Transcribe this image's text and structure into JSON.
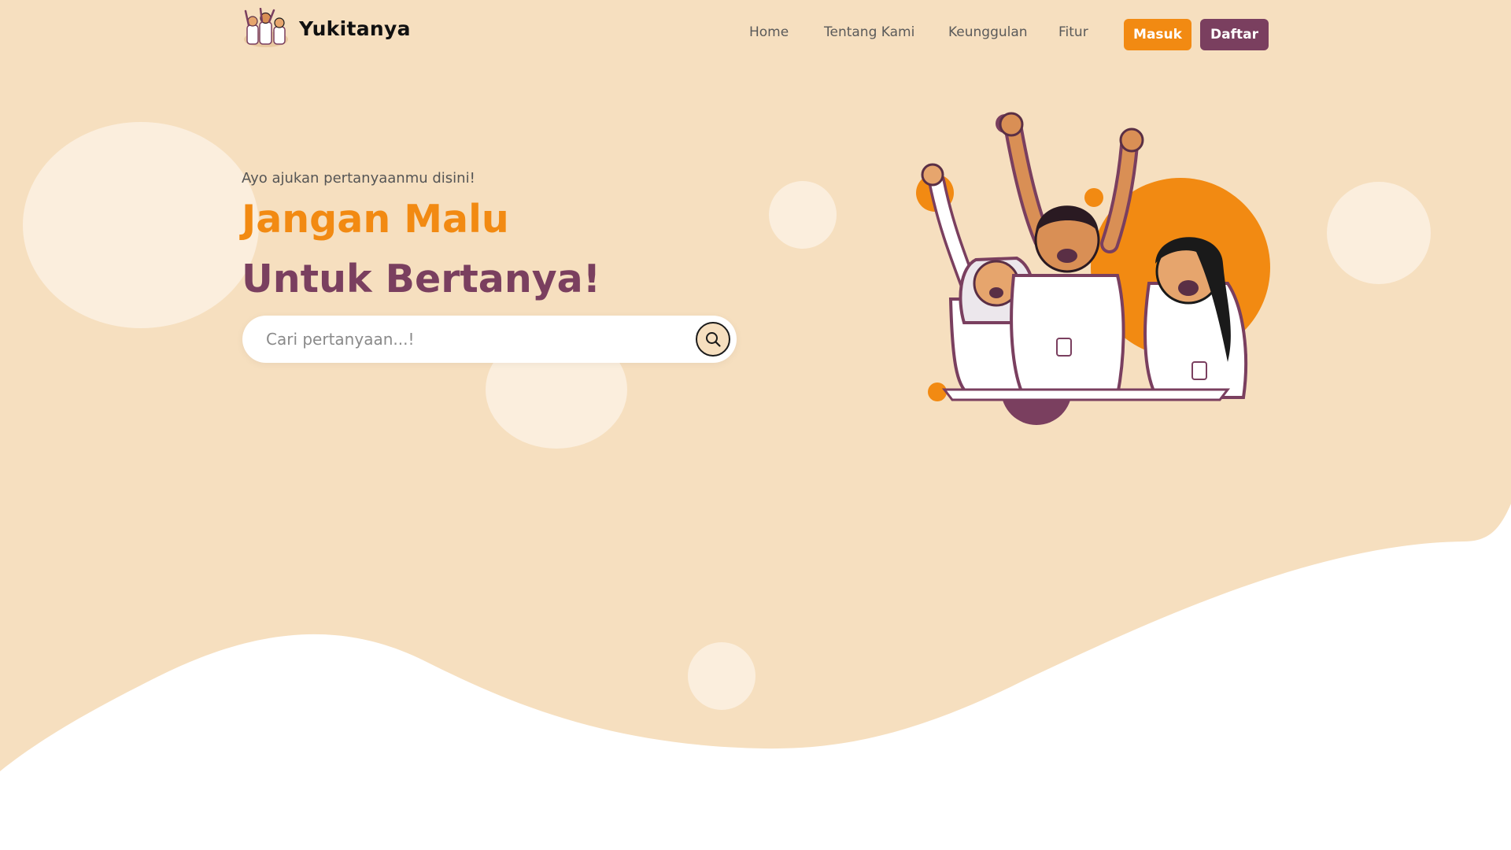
{
  "brand": {
    "name": "Yukitanya",
    "logo_icon": "students-cheering-logo"
  },
  "nav": {
    "links": [
      "Home",
      "Tentang Kami",
      "Keunggulan",
      "Fitur"
    ],
    "masuk_label": "Masuk",
    "daftar_label": "Daftar"
  },
  "hero": {
    "subtitle": "Ayo ajukan pertanyaanmu disini!",
    "headline_line1": "Jangan Malu",
    "headline_line2": "Untuk Bertanya!",
    "illustration": "three-students-raising-hands"
  },
  "search": {
    "placeholder": "Cari pertanyaan...!",
    "value": "",
    "icon": "search-icon"
  },
  "colors": {
    "background": "#f6dfbf",
    "accent_orange": "#f28a12",
    "accent_purple": "#7a3f5f",
    "circle_light": "#fbeedd"
  }
}
